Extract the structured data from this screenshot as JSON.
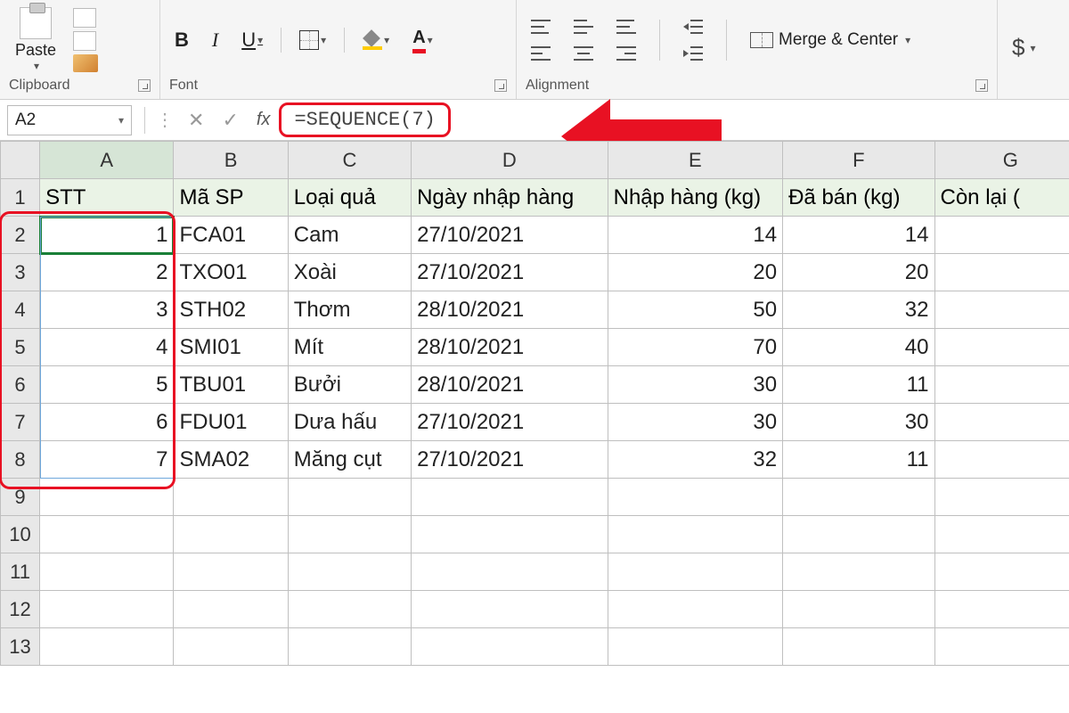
{
  "ribbon": {
    "paste_label": "Paste",
    "clipboard_group": "Clipboard",
    "font_group": "Font",
    "alignment_group": "Alignment",
    "bold": "B",
    "italic": "I",
    "underline": "U",
    "merge_label": "Merge & Center",
    "currency": "$"
  },
  "namebox": "A2",
  "fx_label": "fx",
  "formula": "=SEQUENCE(7)",
  "columns": [
    "A",
    "B",
    "C",
    "D",
    "E",
    "F",
    "G"
  ],
  "headers": {
    "A": "STT",
    "B": "Mã SP",
    "C": "Loại quả",
    "D": "Ngày nhập hàng",
    "E": "Nhập hàng (kg)",
    "F": "Đã bán (kg)",
    "G": "Còn lại ("
  },
  "rows": [
    {
      "n": "2",
      "A": "1",
      "B": "FCA01",
      "C": "Cam",
      "D": "27/10/2021",
      "E": "14",
      "F": "14"
    },
    {
      "n": "3",
      "A": "2",
      "B": "TXO01",
      "C": "Xoài",
      "D": "27/10/2021",
      "E": "20",
      "F": "20"
    },
    {
      "n": "4",
      "A": "3",
      "B": "STH02",
      "C": "Thơm",
      "D": "28/10/2021",
      "E": "50",
      "F": "32"
    },
    {
      "n": "5",
      "A": "4",
      "B": "SMI01",
      "C": "Mít",
      "D": "28/10/2021",
      "E": "70",
      "F": "40"
    },
    {
      "n": "6",
      "A": "5",
      "B": "TBU01",
      "C": "Bưởi",
      "D": "28/10/2021",
      "E": "30",
      "F": "11"
    },
    {
      "n": "7",
      "A": "6",
      "B": "FDU01",
      "C": "Dưa hấu",
      "D": "27/10/2021",
      "E": "30",
      "F": "30"
    },
    {
      "n": "8",
      "A": "7",
      "B": "SMA02",
      "C": "Măng cụt",
      "D": "27/10/2021",
      "E": "32",
      "F": "11"
    }
  ],
  "empty_rows": [
    "9",
    "10",
    "11",
    "12",
    "13"
  ]
}
